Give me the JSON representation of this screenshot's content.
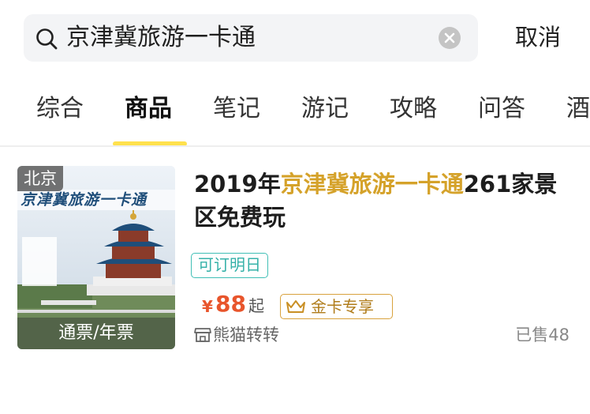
{
  "search": {
    "query": "京津冀旅游一卡通",
    "cancel_label": "取消"
  },
  "tabs": [
    {
      "label": "综合"
    },
    {
      "label": "商品",
      "active": true
    },
    {
      "label": "笔记"
    },
    {
      "label": "游记"
    },
    {
      "label": "攻略"
    },
    {
      "label": "问答"
    },
    {
      "label": "酒"
    }
  ],
  "product": {
    "city": "北京",
    "image_caption": "通票/年票",
    "image_banner_text": "京津冀旅游一卡通",
    "title_prefix": "2019年",
    "title_highlight": "京津冀旅游一卡通",
    "title_suffix": "261家景区免费玩",
    "reserve_tag": "可订明日",
    "currency": "¥",
    "price": "88",
    "price_suffix": "起",
    "gold_tag": "金卡专享",
    "shop_name": "熊猫转转",
    "sold": "已售48"
  },
  "colors": {
    "accent_yellow": "#ffe14d",
    "highlight_gold": "#d5a22a",
    "price_red": "#e8552c",
    "reserve_teal": "#41bfb6"
  }
}
